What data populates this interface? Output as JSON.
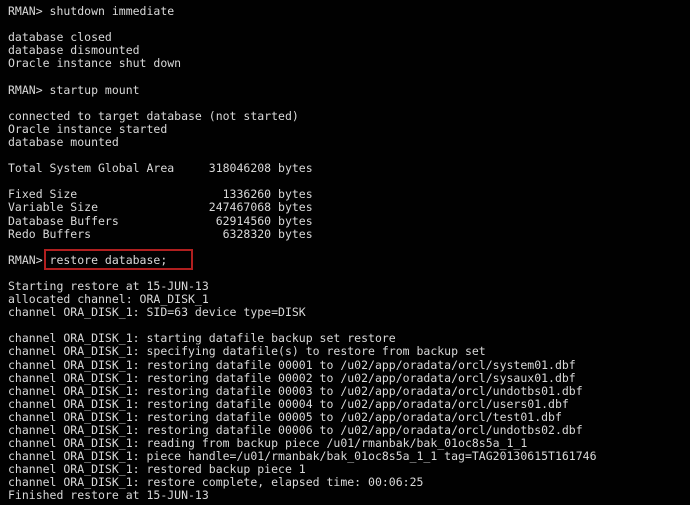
{
  "terminal": {
    "app": "RMAN console",
    "colors": {
      "background": "#010101",
      "text": "#d9d9d9",
      "highlight_border": "#b01f1f"
    },
    "highlight": {
      "target_text": "restore database;",
      "shape": "rectangle",
      "color": "#b01f1f"
    },
    "lines": [
      "RMAN> shutdown immediate",
      "",
      "database closed",
      "database dismounted",
      "Oracle instance shut down",
      "",
      "RMAN> startup mount",
      "",
      "connected to target database (not started)",
      "Oracle instance started",
      "database mounted",
      "",
      "Total System Global Area     318046208 bytes",
      "",
      "Fixed Size                     1336260 bytes",
      "Variable Size                247467068 bytes",
      "Database Buffers              62914560 bytes",
      "Redo Buffers                   6328320 bytes",
      "",
      "RMAN> restore database;",
      "",
      "Starting restore at 15-JUN-13",
      "allocated channel: ORA_DISK_1",
      "channel ORA_DISK_1: SID=63 device type=DISK",
      "",
      "channel ORA_DISK_1: starting datafile backup set restore",
      "channel ORA_DISK_1: specifying datafile(s) to restore from backup set",
      "channel ORA_DISK_1: restoring datafile 00001 to /u02/app/oradata/orcl/system01.dbf",
      "channel ORA_DISK_1: restoring datafile 00002 to /u02/app/oradata/orcl/sysaux01.dbf",
      "channel ORA_DISK_1: restoring datafile 00003 to /u02/app/oradata/orcl/undotbs01.dbf",
      "channel ORA_DISK_1: restoring datafile 00004 to /u02/app/oradata/orcl/users01.dbf",
      "channel ORA_DISK_1: restoring datafile 00005 to /u02/app/oradata/orcl/test01.dbf",
      "channel ORA_DISK_1: restoring datafile 00006 to /u02/app/oradata/orcl/undotbs02.dbf",
      "channel ORA_DISK_1: reading from backup piece /u01/rmanbak/bak_01oc8s5a_1_1",
      "channel ORA_DISK_1: piece handle=/u01/rmanbak/bak_01oc8s5a_1_1 tag=TAG20130615T161746",
      "channel ORA_DISK_1: restored backup piece 1",
      "channel ORA_DISK_1: restore complete, elapsed time: 00:06:25",
      "Finished restore at 15-JUN-13"
    ]
  }
}
